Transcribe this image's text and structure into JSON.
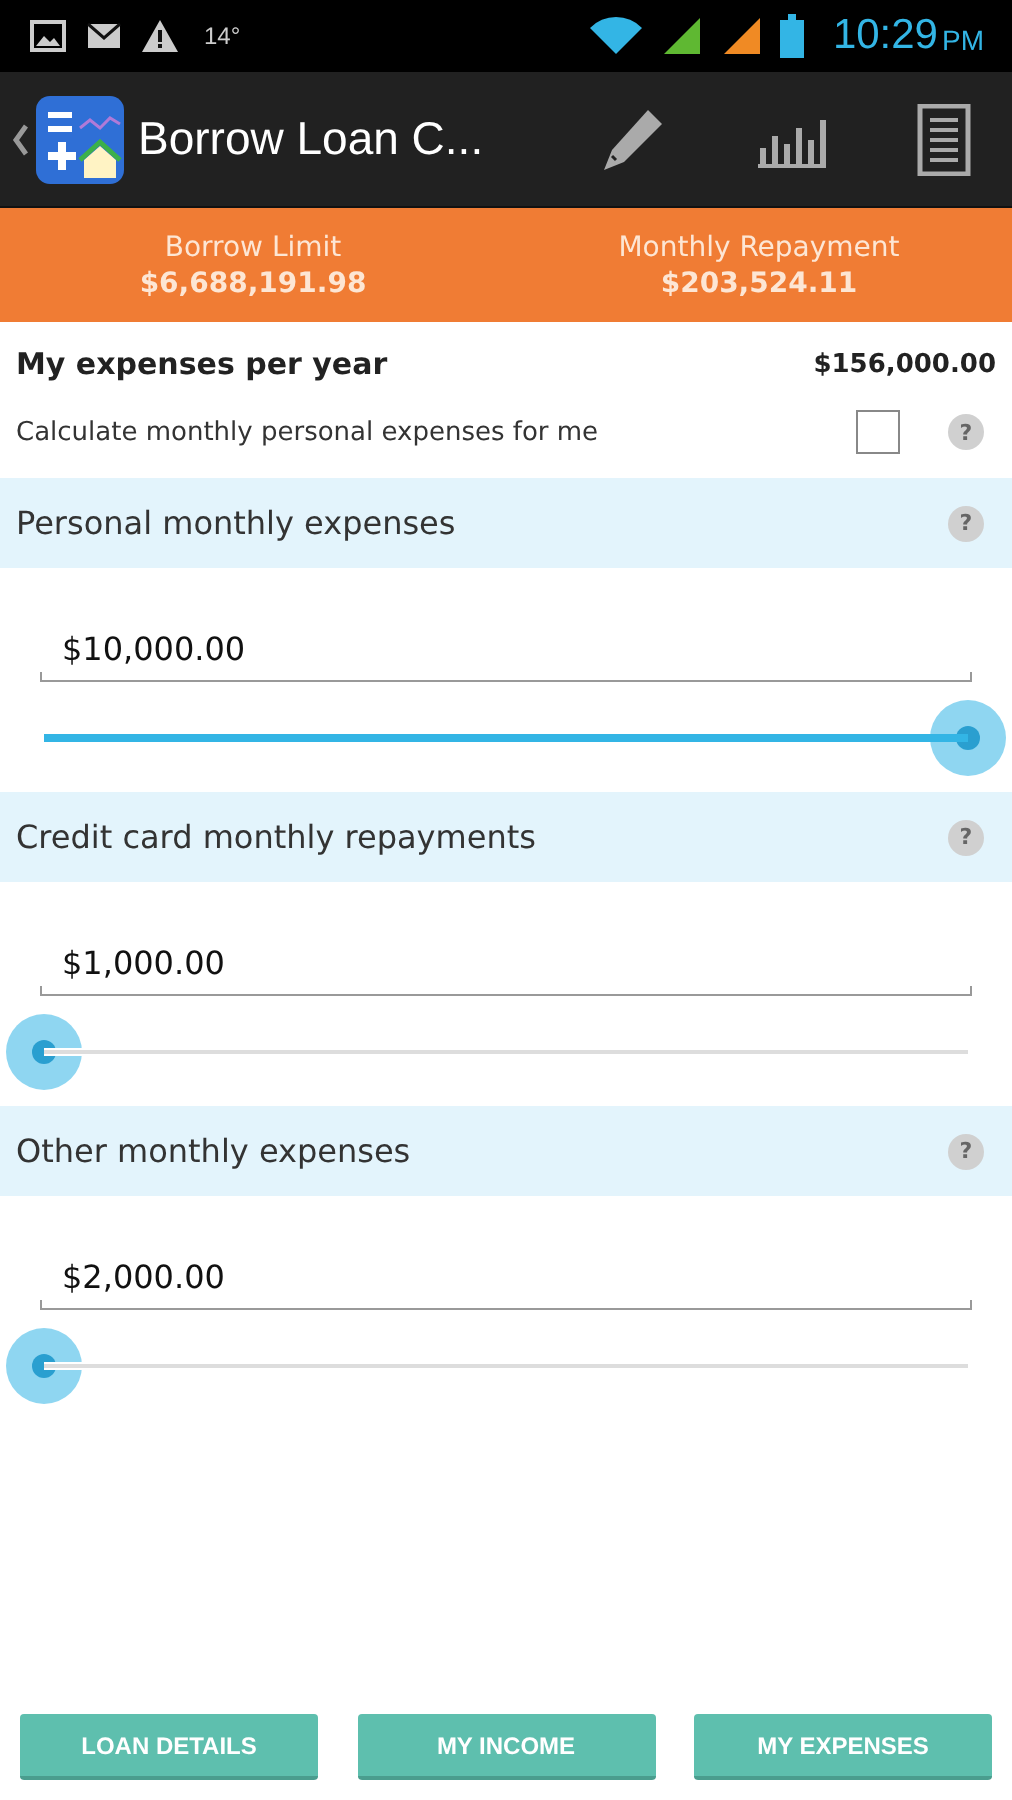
{
  "status_bar": {
    "temperature": "14°",
    "time": "10:29",
    "ampm": "PM"
  },
  "action_bar": {
    "title": "Borrow Loan C..."
  },
  "summary": [
    {
      "label": "Borrow Limit",
      "value": "$6,688,191.98"
    },
    {
      "label": "Monthly Repayment",
      "value": "$203,524.11"
    }
  ],
  "expenses_header": {
    "title": "My expenses per year",
    "total": "$156,000.00"
  },
  "auto_calc": {
    "label": "Calculate monthly personal expenses for me",
    "checked": false,
    "help": "?"
  },
  "sections": [
    {
      "title": "Personal monthly expenses",
      "help": "?",
      "value": "$10,000.00",
      "level": 1
    },
    {
      "title": "Credit card monthly repayments",
      "help": "?",
      "value": "$1,000.00",
      "level": 0
    },
    {
      "title": "Other monthly expenses",
      "help": "?",
      "value": "$2,000.00",
      "level": 0
    }
  ],
  "buttons": [
    "LOAN DETAILS",
    "MY INCOME",
    "MY EXPENSES"
  ]
}
